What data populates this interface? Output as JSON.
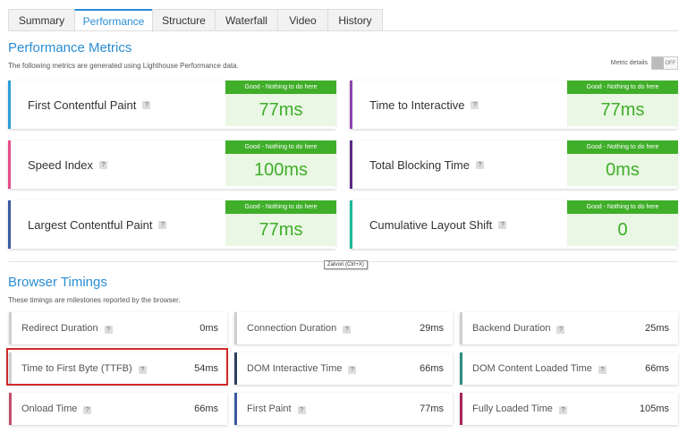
{
  "tabs": [
    "Summary",
    "Performance",
    "Structure",
    "Waterfall",
    "Video",
    "History"
  ],
  "perf": {
    "title": "Performance Metrics",
    "subtitle": "The following metrics are generated using Lighthouse Performance data.",
    "metric_details_label": "Metric details",
    "toggle_text": "OFF",
    "help": "?",
    "metrics": [
      {
        "name": "First Contentful Paint",
        "status": "Good - Nothing to do here",
        "value": "77ms",
        "color": "#2a9fd8"
      },
      {
        "name": "Time to Interactive",
        "status": "Good - Nothing to do here",
        "value": "77ms",
        "color": "#8e44ad"
      },
      {
        "name": "Speed Index",
        "status": "Good - Nothing to do here",
        "value": "100ms",
        "color": "#e84c8b"
      },
      {
        "name": "Total Blocking Time",
        "status": "Good - Nothing to do here",
        "value": "0ms",
        "color": "#5b2a86"
      },
      {
        "name": "Largest Contentful Paint",
        "status": "Good - Nothing to do here",
        "value": "77ms",
        "color": "#3a5ba0"
      },
      {
        "name": "Cumulative Layout Shift",
        "status": "Good - Nothing to do here",
        "value": "0",
        "color": "#1abc9c"
      }
    ]
  },
  "tooltip": "Zatvori (Ctrl+X)",
  "timings": {
    "title": "Browser Timings",
    "subtitle": "These timings are milestones reported by the browser.",
    "items": [
      {
        "name": "Redirect Duration",
        "value": "0ms",
        "color": "#cfcfcf"
      },
      {
        "name": "Connection Duration",
        "value": "29ms",
        "color": "#cfcfcf"
      },
      {
        "name": "Backend Duration",
        "value": "25ms",
        "color": "#cfcfcf"
      },
      {
        "name": "Time to First Byte (TTFB)",
        "value": "54ms",
        "color": "#cfcfcf"
      },
      {
        "name": "DOM Interactive Time",
        "value": "66ms",
        "color": "#2f3f5f"
      },
      {
        "name": "DOM Content Loaded Time",
        "value": "66ms",
        "color": "#2c8c7c"
      },
      {
        "name": "Onload Time",
        "value": "66ms",
        "color": "#c0506e"
      },
      {
        "name": "First Paint",
        "value": "77ms",
        "color": "#3a5ba0"
      },
      {
        "name": "Fully Loaded Time",
        "value": "105ms",
        "color": "#a8245a"
      }
    ]
  }
}
